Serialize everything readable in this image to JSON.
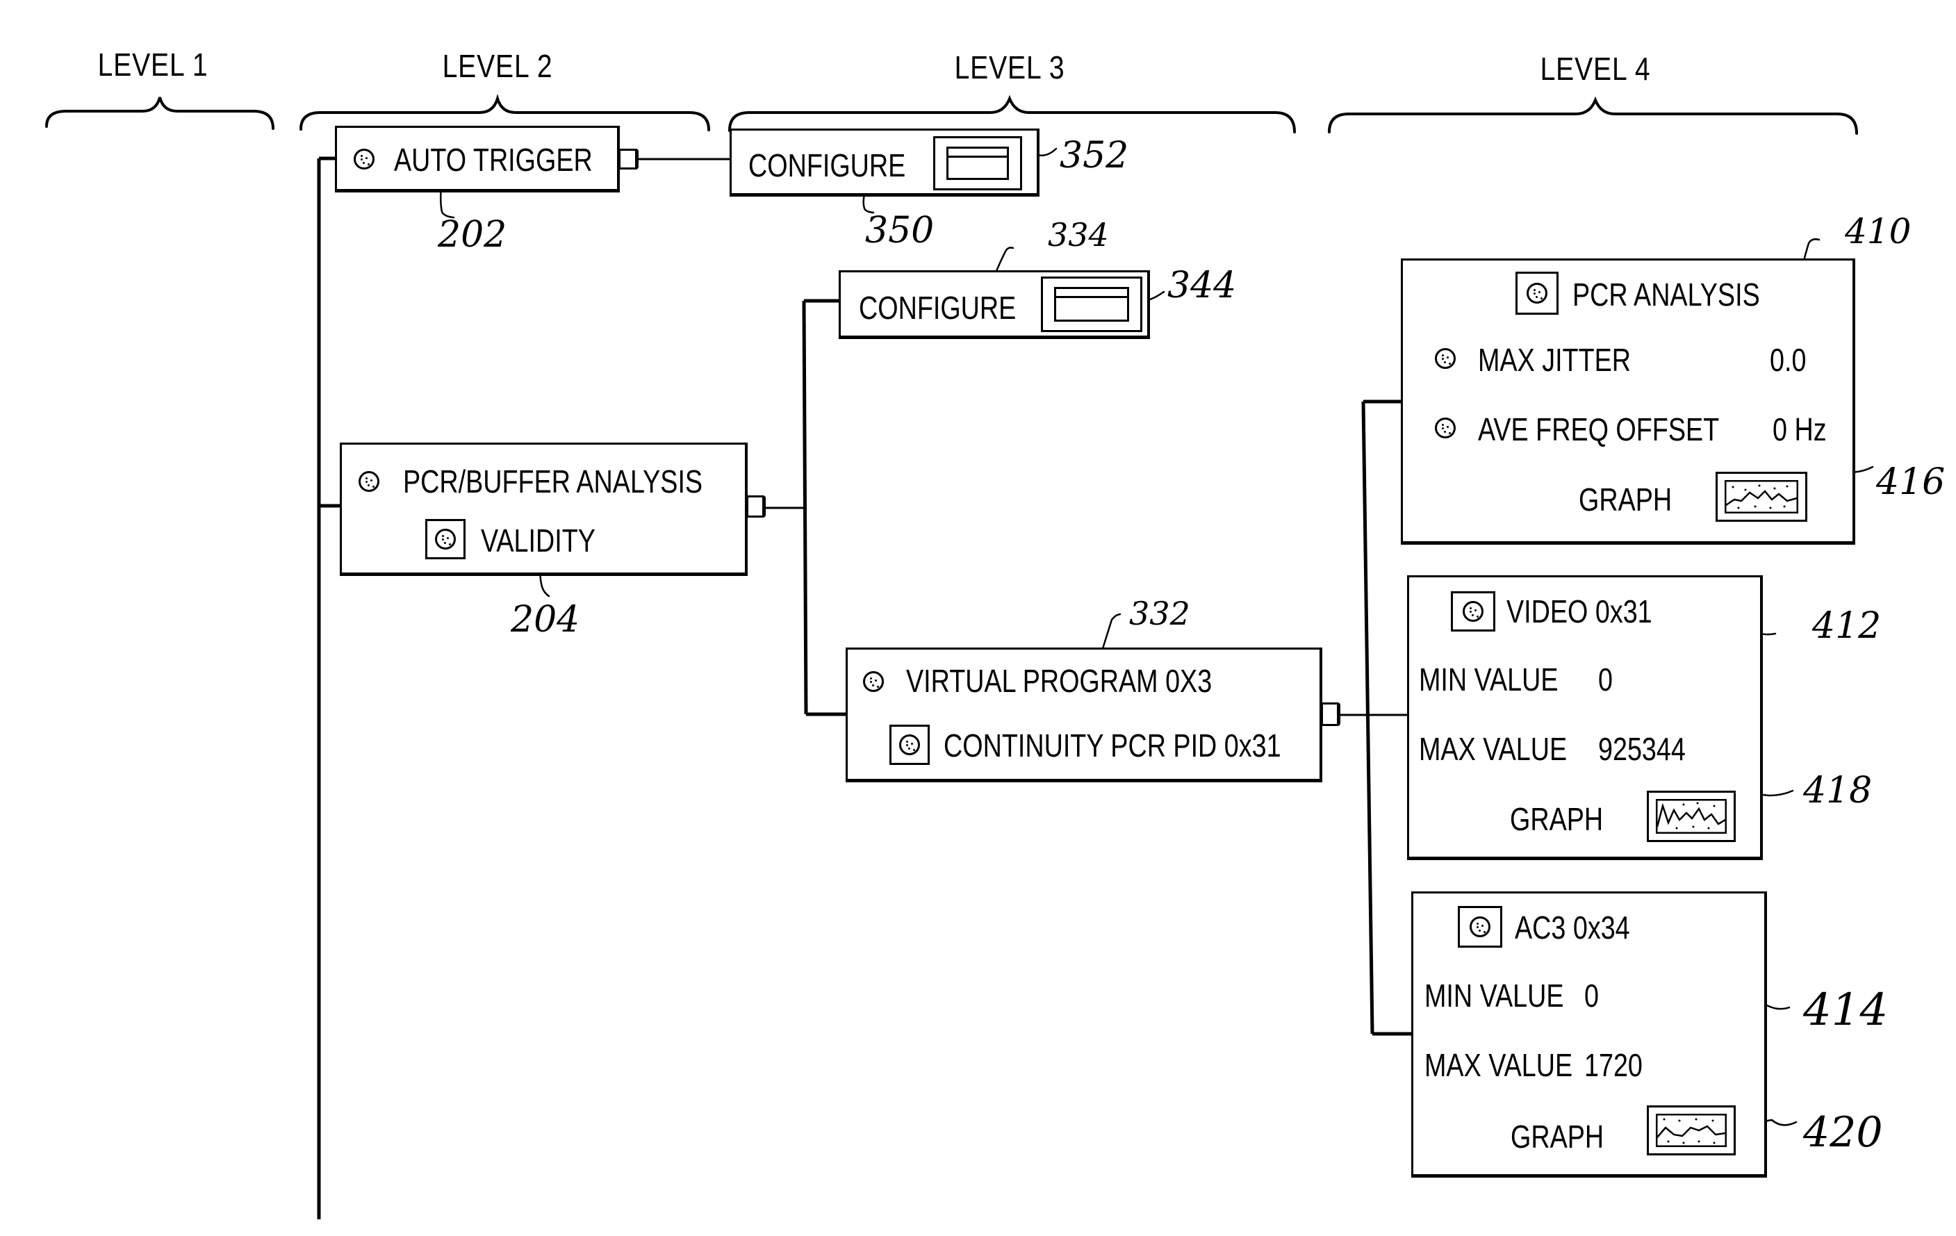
{
  "levels": [
    {
      "label": "LEVEL 1"
    },
    {
      "label": "LEVEL 2"
    },
    {
      "label": "LEVEL 3"
    },
    {
      "label": "LEVEL 4"
    }
  ],
  "level2": {
    "auto_trigger": {
      "label": "AUTO TRIGGER",
      "ref": "202",
      "icon": "indicator-led-icon"
    },
    "pcr_buffer": {
      "label": "PCR/BUFFER ANALYSIS",
      "sub_label": "VALIDITY",
      "ref": "204",
      "icon": "indicator-led-icon"
    }
  },
  "level3": {
    "configure_trigger": {
      "label": "CONFIGURE",
      "ref": "350",
      "icon_ref": "352",
      "icon": "window-icon"
    },
    "configure_buffer": {
      "label": "CONFIGURE",
      "ref": "334",
      "icon_ref": "344",
      "icon": "window-icon"
    },
    "virtual_program": {
      "label": "VIRTUAL PROGRAM 0X3",
      "sub_label": "CONTINUITY PCR PID 0x31",
      "ref": "332",
      "icon": "indicator-led-icon"
    }
  },
  "level4": {
    "pcr_analysis": {
      "title": "PCR ANALYSIS",
      "ref": "410",
      "rows": [
        {
          "label": "MAX JITTER",
          "value": "0.0"
        },
        {
          "label": "AVE FREQ OFFSET",
          "value": "0 Hz"
        }
      ],
      "graph_label": "GRAPH",
      "graph_ref": "416"
    },
    "video": {
      "title": "VIDEO  0x31",
      "ref": "412",
      "min_label": "MIN VALUE",
      "min_value": "0",
      "max_label": "MAX VALUE",
      "max_value": "925344",
      "graph_label": "GRAPH",
      "graph_ref": "418"
    },
    "ac3": {
      "title": "AC3  0x34",
      "ref": "414",
      "min_label": "MIN VALUE",
      "min_value": "0",
      "max_label": "MAX VALUE",
      "max_value": "1720",
      "graph_label": "GRAPH",
      "graph_ref": "420"
    }
  }
}
